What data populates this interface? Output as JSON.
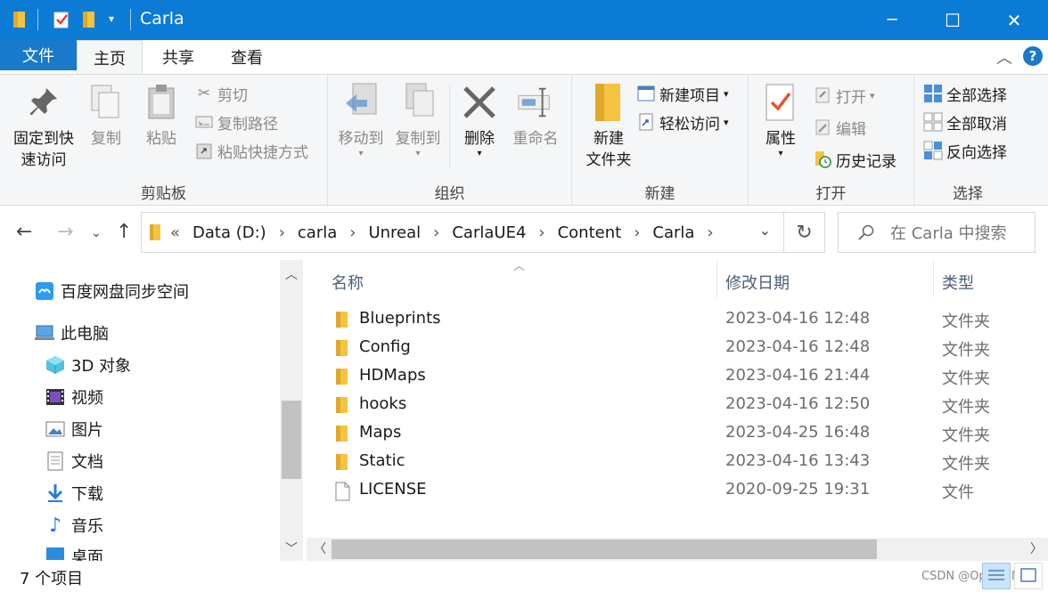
{
  "window": {
    "title": "Carla",
    "minimize_glyph": "─",
    "maximize_glyph": "☐",
    "close_glyph": "✕"
  },
  "tabs": {
    "file": "文件",
    "items": [
      "主页",
      "共享",
      "查看"
    ]
  },
  "ribbon": {
    "clipboard": {
      "label": "剪贴板",
      "pin": "固定到快\n速访问",
      "copy": "复制",
      "paste": "粘贴",
      "cut": "剪切",
      "copy_path": "复制路径",
      "paste_shortcut": "粘贴快捷方式"
    },
    "organize": {
      "label": "组织",
      "move_to": "移动到",
      "copy_to": "复制到",
      "delete": "删除",
      "rename": "重命名"
    },
    "new": {
      "label": "新建",
      "new_folder": "新建\n文件夹",
      "new_item": "新建项目",
      "easy_access": "轻松访问"
    },
    "open": {
      "label": "打开",
      "properties": "属性",
      "open": "打开",
      "edit": "编辑",
      "history": "历史记录"
    },
    "select": {
      "label": "选择",
      "select_all": "全部选择",
      "select_none": "全部取消",
      "invert": "反向选择"
    }
  },
  "address": {
    "overflow": "«",
    "segments": [
      "Data (D:)",
      "carla",
      "Unreal",
      "CarlaUE4",
      "Content",
      "Carla"
    ],
    "search_placeholder": "在 Carla 中搜索"
  },
  "navpane": {
    "items": [
      {
        "label": "百度网盘同步空间",
        "icon": "baidu-netdisk-icon"
      },
      {
        "label": "此电脑",
        "icon": "this-pc-icon"
      },
      {
        "label": "3D 对象",
        "icon": "3d-objects-icon"
      },
      {
        "label": "视频",
        "icon": "videos-icon"
      },
      {
        "label": "图片",
        "icon": "pictures-icon"
      },
      {
        "label": "文档",
        "icon": "documents-icon"
      },
      {
        "label": "下载",
        "icon": "downloads-icon"
      },
      {
        "label": "音乐",
        "icon": "music-icon"
      },
      {
        "label": "桌面",
        "icon": "desktop-icon"
      }
    ]
  },
  "filelist": {
    "columns": {
      "name": "名称",
      "date": "修改日期",
      "type": "类型"
    },
    "rows": [
      {
        "name": "Blueprints",
        "date": "2023-04-16 12:48",
        "type": "文件夹",
        "icon": "folder-icon"
      },
      {
        "name": "Config",
        "date": "2023-04-16 12:48",
        "type": "文件夹",
        "icon": "folder-icon"
      },
      {
        "name": "HDMaps",
        "date": "2023-04-16 21:44",
        "type": "文件夹",
        "icon": "folder-icon"
      },
      {
        "name": "hooks",
        "date": "2023-04-16 12:50",
        "type": "文件夹",
        "icon": "folder-icon"
      },
      {
        "name": "Maps",
        "date": "2023-04-25 16:48",
        "type": "文件夹",
        "icon": "folder-icon"
      },
      {
        "name": "Static",
        "date": "2023-04-16 13:43",
        "type": "文件夹",
        "icon": "folder-icon"
      },
      {
        "name": "LICENSE",
        "date": "2020-09-25 19:31",
        "type": "文件",
        "icon": "file-icon"
      }
    ]
  },
  "status": {
    "count": "7 个项目",
    "watermark": "CSDN @OpenEIMind"
  },
  "colors": {
    "titlebar": "#0b7bd6",
    "file_tab": "#1979ca",
    "folder": "#f5c342",
    "accent": "#0078d7"
  }
}
